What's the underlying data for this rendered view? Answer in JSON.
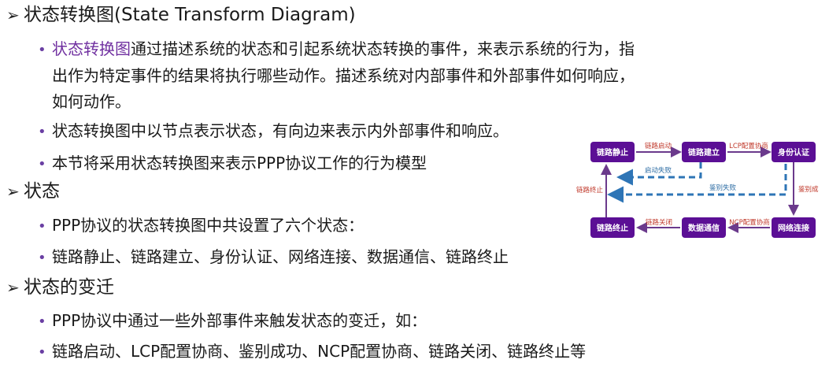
{
  "sections": [
    {
      "heading": "状态转换图(State Transform Diagram)",
      "bullets": [
        {
          "highlight": "状态转换图",
          "lines": [
            "通过描述系统的状态和引起系统状态转换的事件，来表示系统的行为，指",
            "出作为特定事件的结果将执行哪些动作。描述系统对内部事件和外部事件如何响应，",
            "如何动作。"
          ]
        },
        {
          "highlight": "",
          "lines": [
            "状态转换图中以节点表示状态，有向边来表示内外部事件和响应。"
          ]
        },
        {
          "highlight": "",
          "lines": [
            "本节将采用状态转换图来表示PPP协议工作的行为模型"
          ]
        }
      ]
    },
    {
      "heading": "状态",
      "bullets": [
        {
          "highlight": "",
          "lines": [
            "PPP协议的状态转换图中共设置了六个状态："
          ]
        },
        {
          "highlight": "",
          "lines": [
            "链路静止、链路建立、身份认证、网络连接、数据通信、链路终止"
          ]
        }
      ]
    },
    {
      "heading": "状态的变迁",
      "bullets": [
        {
          "highlight": "",
          "lines": [
            "PPP协议中通过一些外部事件来触发状态的变迁，如："
          ]
        },
        {
          "highlight": "",
          "lines": [
            "链路启动、LCP配置协商、鉴别成功、NCP配置协商、链路关闭、链路终止等"
          ]
        }
      ]
    }
  ],
  "diagram": {
    "nodes": {
      "dead": "链路静止",
      "establish": "链路建立",
      "auth": "身份认证",
      "network": "网络连接",
      "data": "数据通信",
      "terminate": "链路终止"
    },
    "edges": {
      "link_up": "链路启动",
      "lcp": "LCP配置协商",
      "auth_ok": "鉴别成功",
      "ncp": "NCP配置协商",
      "link_close": "链路关闭",
      "link_end": "链路终止",
      "start_fail": "启动失败",
      "auth_fail": "鉴别失败"
    },
    "colors": {
      "node": "#5b0f95",
      "solid_edge": "#6b3a8c",
      "label_red": "#c0392b",
      "label_blue": "#2e6da4",
      "dashed_edge": "#2e75b6",
      "accent_text": "#7030a0"
    }
  }
}
